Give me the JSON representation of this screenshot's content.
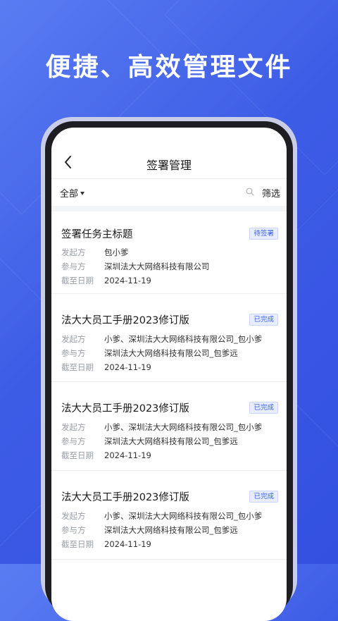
{
  "headline": "便捷、高效管理文件",
  "nav": {
    "title": "签署管理",
    "back_icon": "chevron-left-icon"
  },
  "filter": {
    "all_label": "全部",
    "filter_label": "筛选",
    "search_icon": "search-icon"
  },
  "labels": {
    "initiator": "发起方",
    "participants": "参与方",
    "deadline": "截至日期"
  },
  "colors": {
    "brand_blue": "#3d5ce6",
    "badge_text": "#3a63e8",
    "badge_bg": "#e8eeff"
  },
  "cards": [
    {
      "title": "签署任务主标题",
      "status": "待签署",
      "initiator": "包小爹",
      "participants": "深圳法大大网络科技有限公司",
      "deadline": "2024-11-19"
    },
    {
      "title": "法大大员工手册2023修订版",
      "status": "已完成",
      "initiator": "小爹、深圳法大大网络科技有限公司_包小爹",
      "participants": "深圳法大大网络科技有限公司_包爹远",
      "deadline": "2024-11-19"
    },
    {
      "title": "法大大员工手册2023修订版",
      "status": "已完成",
      "initiator": "小爹、深圳法大大网络科技有限公司_包小爹",
      "participants": "深圳法大大网络科技有限公司_包爹远",
      "deadline": "2024-11-19"
    },
    {
      "title": "法大大员工手册2023修订版",
      "status": "已完成",
      "initiator": "小爹、深圳法大大网络科技有限公司_包小爹",
      "participants": "深圳法大大网络科技有限公司_包爹远",
      "deadline": "2024-11-19"
    }
  ]
}
